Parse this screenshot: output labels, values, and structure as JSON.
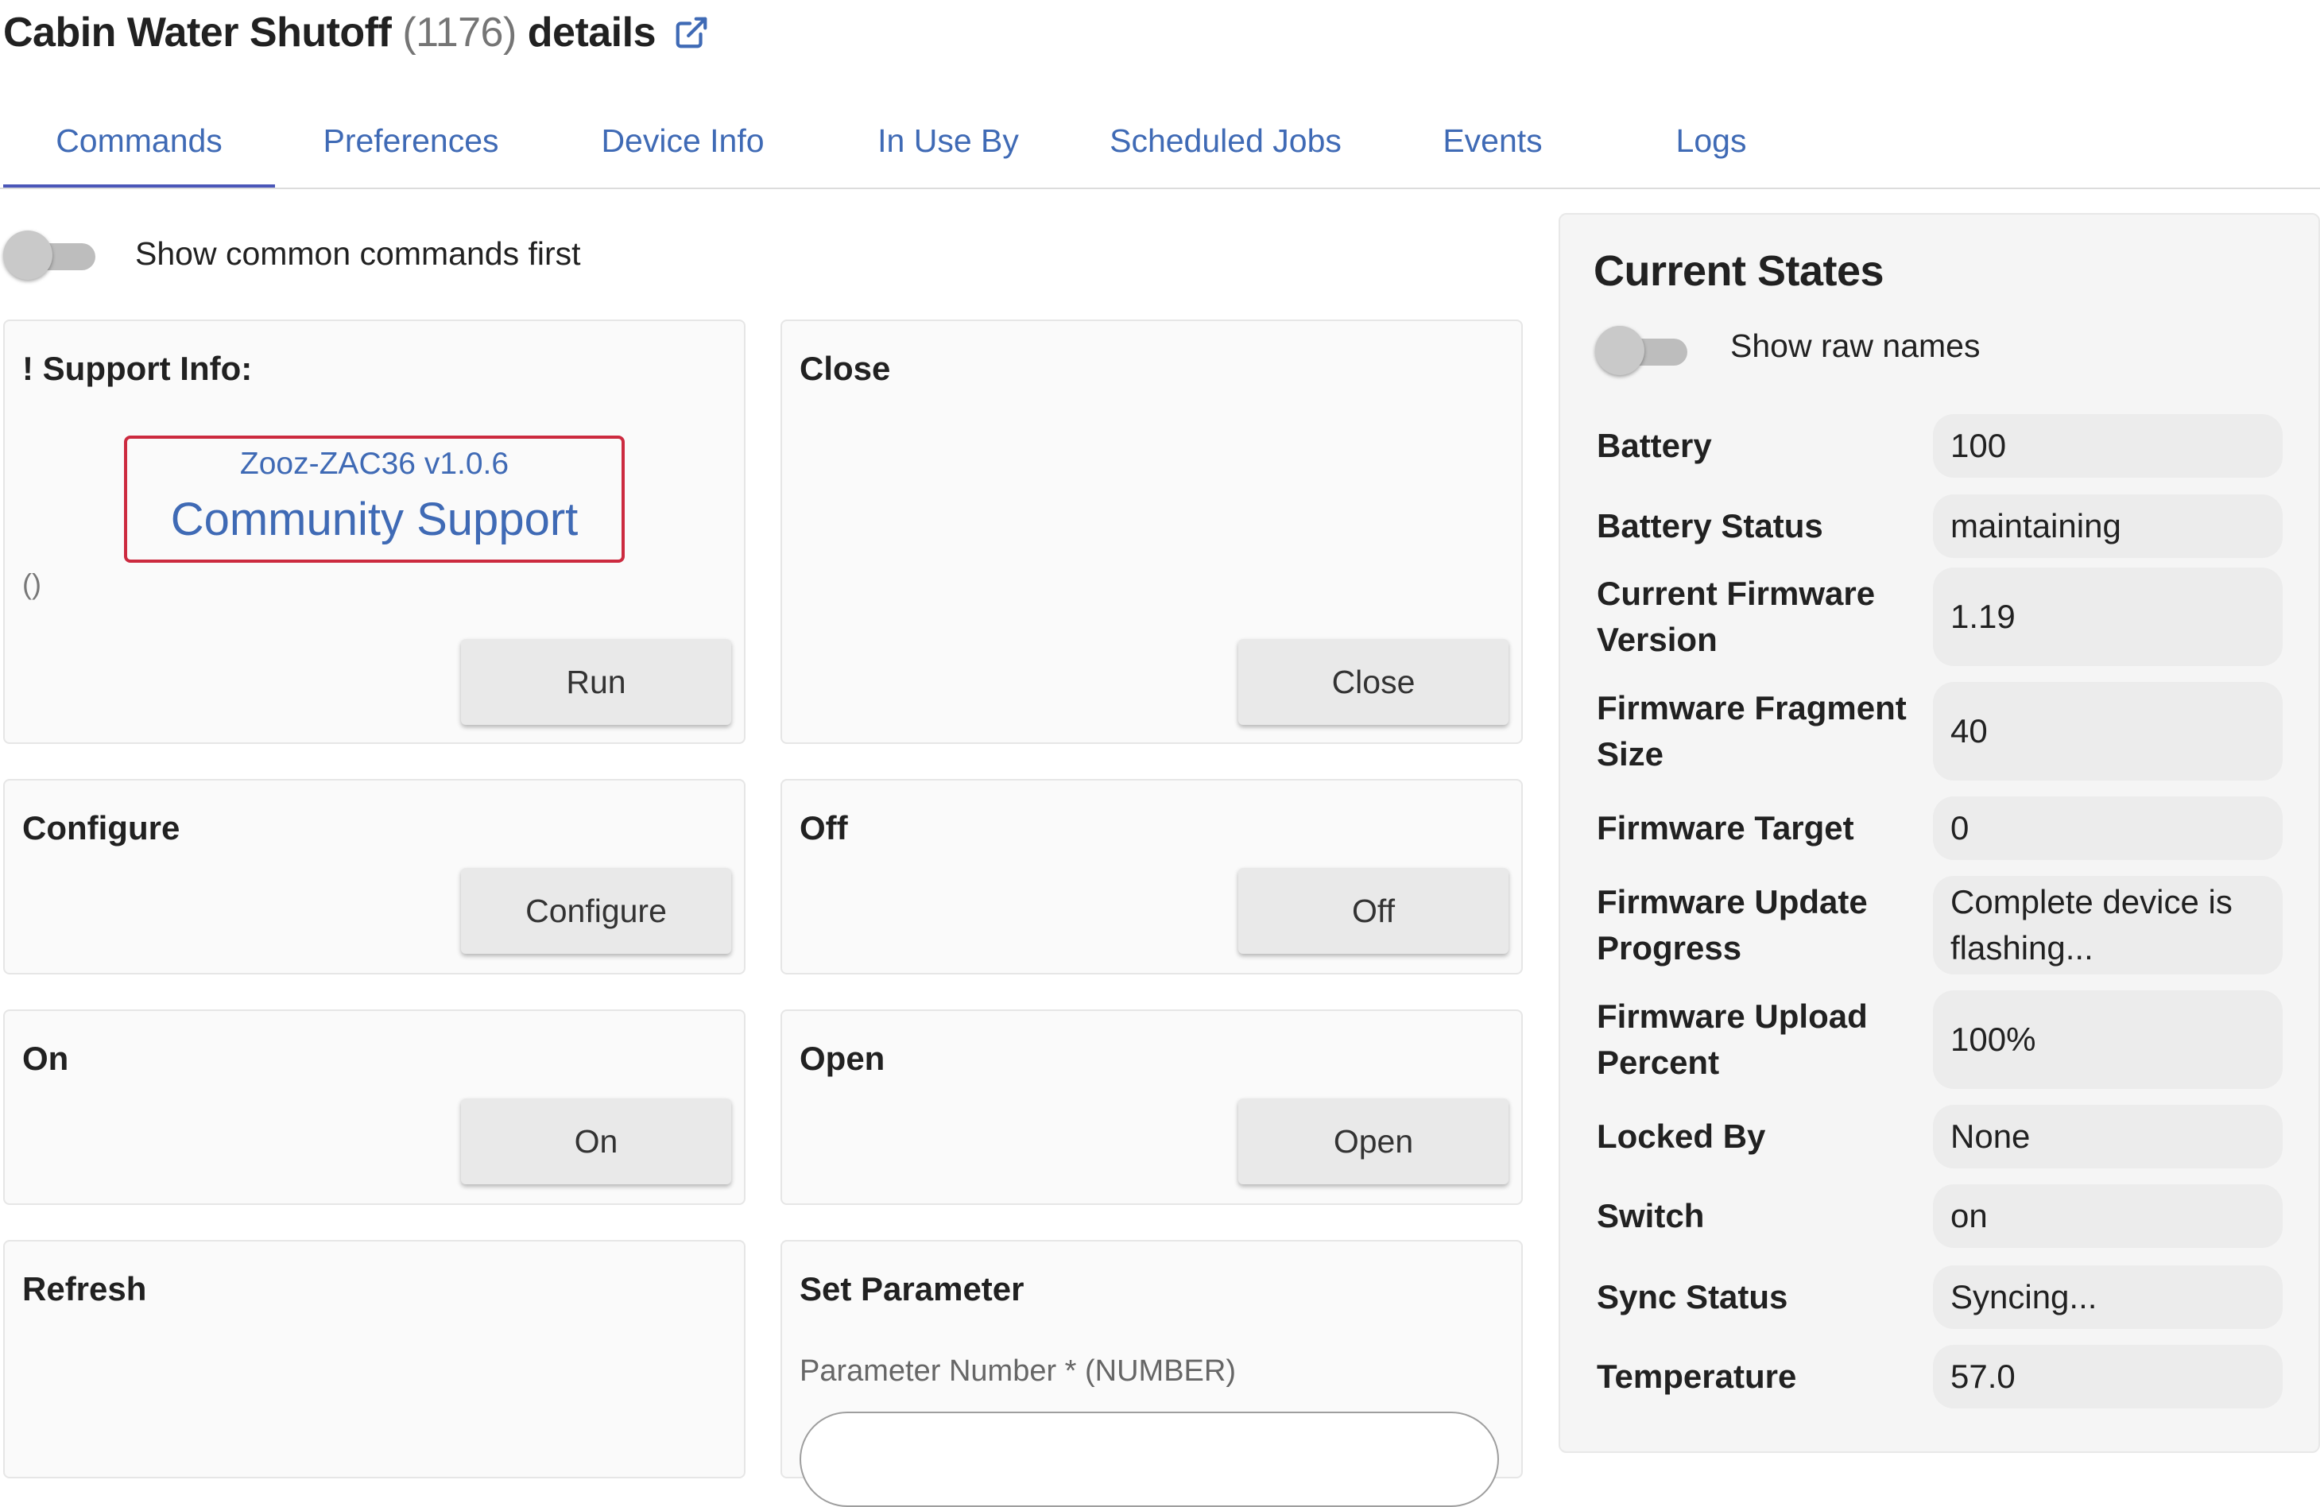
{
  "header": {
    "device_name": "Cabin Water Shutoff",
    "device_id": "(1176)",
    "suffix": "details",
    "external_link_icon": "external-link-icon"
  },
  "tabs": [
    {
      "label": "Commands",
      "active": true
    },
    {
      "label": "Preferences"
    },
    {
      "label": "Device Info"
    },
    {
      "label": "In Use By"
    },
    {
      "label": "Scheduled Jobs"
    },
    {
      "label": "Events"
    },
    {
      "label": "Logs"
    }
  ],
  "commands": {
    "common_toggle_label": "Show common commands first",
    "cards": {
      "support": {
        "title": "! Support Info:",
        "version": "Zooz-ZAC36 v1.0.6",
        "link": "Community Support",
        "args": "()",
        "button": "Run"
      },
      "close": {
        "title": "Close",
        "button": "Close"
      },
      "configure": {
        "title": "Configure",
        "button": "Configure"
      },
      "off": {
        "title": "Off",
        "button": "Off"
      },
      "on": {
        "title": "On",
        "button": "On"
      },
      "open": {
        "title": "Open",
        "button": "Open"
      },
      "refresh": {
        "title": "Refresh"
      },
      "set_parameter": {
        "title": "Set Parameter",
        "param_label": "Parameter Number * (NUMBER)"
      }
    }
  },
  "current_states": {
    "title": "Current States",
    "raw_names_label": "Show raw names",
    "rows": [
      {
        "label": "Battery",
        "value": "100"
      },
      {
        "label": "Battery Status",
        "value": "maintaining"
      },
      {
        "label": "Current Firmware Version",
        "value": "1.19"
      },
      {
        "label": "Firmware Fragment Size",
        "value": "40"
      },
      {
        "label": "Firmware Target",
        "value": "0"
      },
      {
        "label": "Firmware Update Progress",
        "value": "Complete device is flashing..."
      },
      {
        "label": "Firmware Upload Percent",
        "value": "100%"
      },
      {
        "label": "Locked By",
        "value": "None"
      },
      {
        "label": "Switch",
        "value": "on"
      },
      {
        "label": "Sync Status",
        "value": "Syncing..."
      },
      {
        "label": "Temperature",
        "value": "57.0"
      }
    ]
  },
  "colors": {
    "link": "#3f6ab5",
    "tab_indicator": "#4a56b8",
    "support_border": "#cc2a3f"
  }
}
